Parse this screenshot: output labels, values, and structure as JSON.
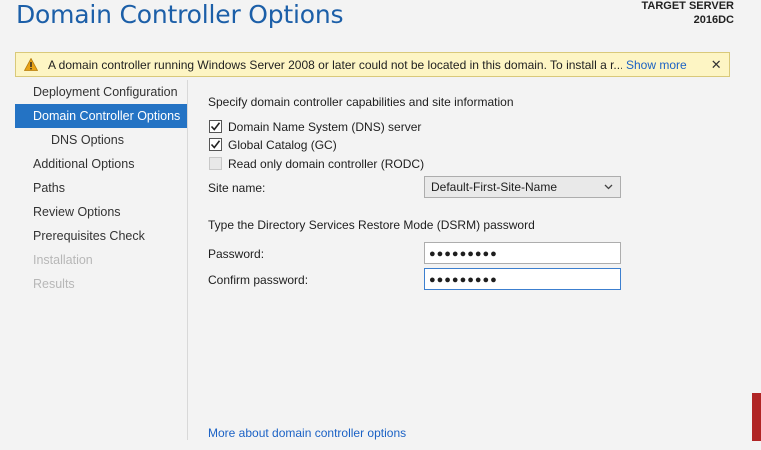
{
  "header": {
    "title": "Domain Controller Options",
    "target_label": "TARGET SERVER",
    "target_server": "2016DC"
  },
  "warning": {
    "text": "A domain controller running Windows Server 2008 or later could not be located in this domain. To install a r...",
    "show_more": "Show more",
    "close": "✕"
  },
  "nav": {
    "items": [
      {
        "label": "Deployment Configuration",
        "state": "normal"
      },
      {
        "label": "Domain Controller Options",
        "state": "active"
      },
      {
        "label": "DNS Options",
        "state": "sub"
      },
      {
        "label": "Additional Options",
        "state": "normal"
      },
      {
        "label": "Paths",
        "state": "normal"
      },
      {
        "label": "Review Options",
        "state": "normal"
      },
      {
        "label": "Prerequisites Check",
        "state": "normal"
      },
      {
        "label": "Installation",
        "state": "disabled"
      },
      {
        "label": "Results",
        "state": "disabled"
      }
    ]
  },
  "capabilities": {
    "heading": "Specify domain controller capabilities and site information",
    "dns": {
      "label": "Domain Name System (DNS) server",
      "checked": true
    },
    "gc": {
      "label": "Global Catalog (GC)",
      "checked": true
    },
    "rodc": {
      "label": "Read only domain controller (RODC)",
      "checked": false,
      "disabled": true
    }
  },
  "site": {
    "label": "Site name:",
    "value": "Default-First-Site-Name"
  },
  "dsrm": {
    "heading": "Type the Directory Services Restore Mode (DSRM) password",
    "password_label": "Password:",
    "password_value": "●●●●●●●●●",
    "confirm_label": "Confirm password:",
    "confirm_value": "●●●●●●●●●"
  },
  "footer": {
    "link": "More about domain controller options"
  },
  "colors": {
    "title": "#1c5fa8",
    "active_nav": "#2473c4",
    "link": "#1b62c5",
    "warning_bg": "#fdf5c4"
  }
}
